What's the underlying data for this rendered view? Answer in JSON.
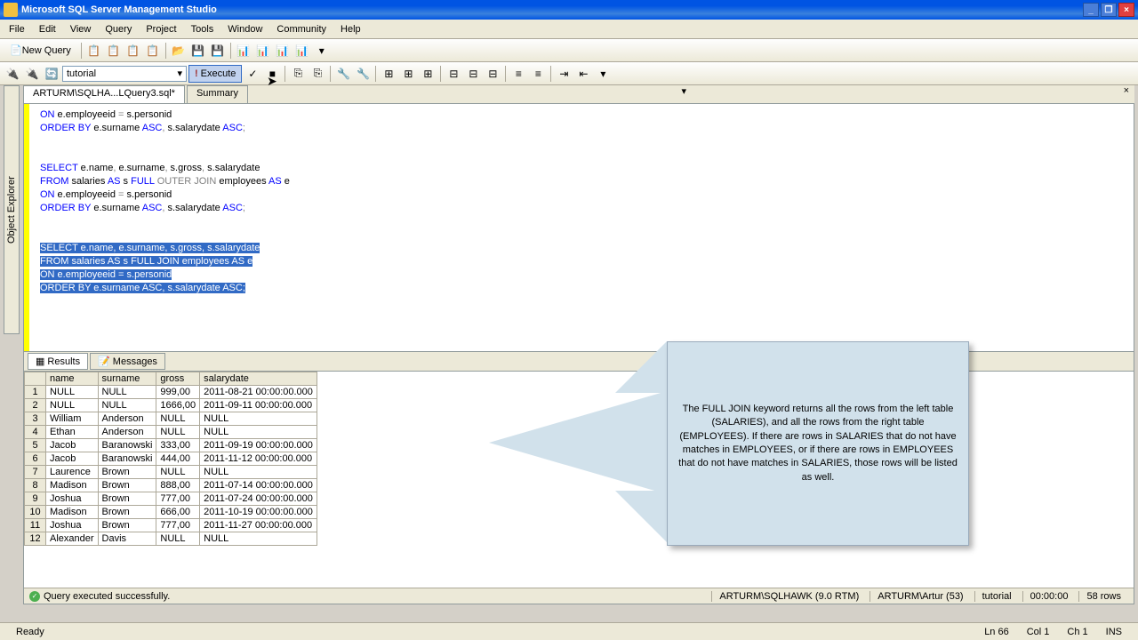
{
  "app": {
    "title": "Microsoft SQL Server Management Studio"
  },
  "menu": {
    "items": [
      "File",
      "Edit",
      "View",
      "Query",
      "Project",
      "Tools",
      "Window",
      "Community",
      "Help"
    ]
  },
  "toolbar": {
    "new_query": "New Query"
  },
  "toolbar2": {
    "database": "tutorial",
    "execute": "Execute"
  },
  "sidebar": {
    "label": "Object Explorer"
  },
  "tabs": {
    "active": "ARTURM\\SQLHA...LQuery3.sql*",
    "summary": "Summary"
  },
  "sql": {
    "line1_a": "ON",
    "line1_b": " e.employeeid ",
    "line1_c": "=",
    "line1_d": " s.personid",
    "line2_a": "ORDER",
    "line2_b": " BY",
    "line2_c": " e.surname ",
    "line2_d": "ASC",
    "line2_e": ",",
    "line2_f": " s.salarydate ",
    "line2_g": "ASC",
    "line2_h": ";",
    "line3_a": "SELECT",
    "line3_b": " e.name",
    "line3_c": ",",
    "line3_d": " e.surname",
    "line3_e": ",",
    "line3_f": " s.gross",
    "line3_g": ",",
    "line3_h": " s.salarydate",
    "line4_a": "FROM",
    "line4_b": " salaries ",
    "line4_c": "AS",
    "line4_d": " s ",
    "line4_e": "FULL",
    "line4_f": " ",
    "line4_g": "OUTER",
    "line4_h": " ",
    "line4_i": "JOIN",
    "line4_j": " employees ",
    "line4_k": "AS",
    "line4_l": " e",
    "line5_a": "ON",
    "line5_b": " e.employeeid ",
    "line5_c": "=",
    "line5_d": " s.personid",
    "line6_a": "ORDER",
    "line6_b": " BY",
    "line6_c": " e.surname ",
    "line6_d": "ASC",
    "line6_e": ",",
    "line6_f": " s.salarydate ",
    "line6_g": "ASC",
    "line6_h": ";",
    "sel_l1": "SELECT e.name, e.surname, s.gross, s.salarydate",
    "sel_l2": "FROM salaries AS s FULL JOIN employees AS e",
    "sel_l3": "ON e.employeeid = s.personid",
    "sel_l4": "ORDER BY e.surname ASC, s.salarydate ASC;"
  },
  "result_tabs": {
    "results": "Results",
    "messages": "Messages"
  },
  "grid": {
    "headers": [
      "",
      "name",
      "surname",
      "gross",
      "salarydate"
    ],
    "rows": [
      {
        "n": "1",
        "name": "NULL",
        "surname": "NULL",
        "gross": "999,00",
        "date": "2011-08-21 00:00:00.000"
      },
      {
        "n": "2",
        "name": "NULL",
        "surname": "NULL",
        "gross": "1666,00",
        "date": "2011-09-11 00:00:00.000"
      },
      {
        "n": "3",
        "name": "William",
        "surname": "Anderson",
        "gross": "NULL",
        "date": "NULL"
      },
      {
        "n": "4",
        "name": "Ethan",
        "surname": "Anderson",
        "gross": "NULL",
        "date": "NULL"
      },
      {
        "n": "5",
        "name": "Jacob",
        "surname": "Baranowski",
        "gross": "333,00",
        "date": "2011-09-19 00:00:00.000"
      },
      {
        "n": "6",
        "name": "Jacob",
        "surname": "Baranowski",
        "gross": "444,00",
        "date": "2011-11-12 00:00:00.000"
      },
      {
        "n": "7",
        "name": "Laurence",
        "surname": "Brown",
        "gross": "NULL",
        "date": "NULL"
      },
      {
        "n": "8",
        "name": "Madison",
        "surname": "Brown",
        "gross": "888,00",
        "date": "2011-07-14 00:00:00.000"
      },
      {
        "n": "9",
        "name": "Joshua",
        "surname": "Brown",
        "gross": "777,00",
        "date": "2011-07-24 00:00:00.000"
      },
      {
        "n": "10",
        "name": "Madison",
        "surname": "Brown",
        "gross": "666,00",
        "date": "2011-10-19 00:00:00.000"
      },
      {
        "n": "11",
        "name": "Joshua",
        "surname": "Brown",
        "gross": "777,00",
        "date": "2011-11-27 00:00:00.000"
      },
      {
        "n": "12",
        "name": "Alexander",
        "surname": "Davis",
        "gross": "NULL",
        "date": "NULL"
      }
    ]
  },
  "status": {
    "msg": "Query executed successfully.",
    "server": "ARTURM\\SQLHAWK (9.0 RTM)",
    "user": "ARTURM\\Artur (53)",
    "db": "tutorial",
    "time": "00:00:00",
    "rows": "58 rows"
  },
  "bottom": {
    "ready": "Ready",
    "ln": "Ln 66",
    "col": "Col 1",
    "ch": "Ch 1",
    "ins": "INS"
  },
  "callout": {
    "text": "The FULL JOIN keyword returns all the rows from the left table (SALARIES), and all the rows from the right table (EMPLOYEES). If there are rows in SALARIES that do not have matches in EMPLOYEES, or if there are rows in EMPLOYEES that do not have matches in SALARIES, those rows will be listed as well."
  }
}
